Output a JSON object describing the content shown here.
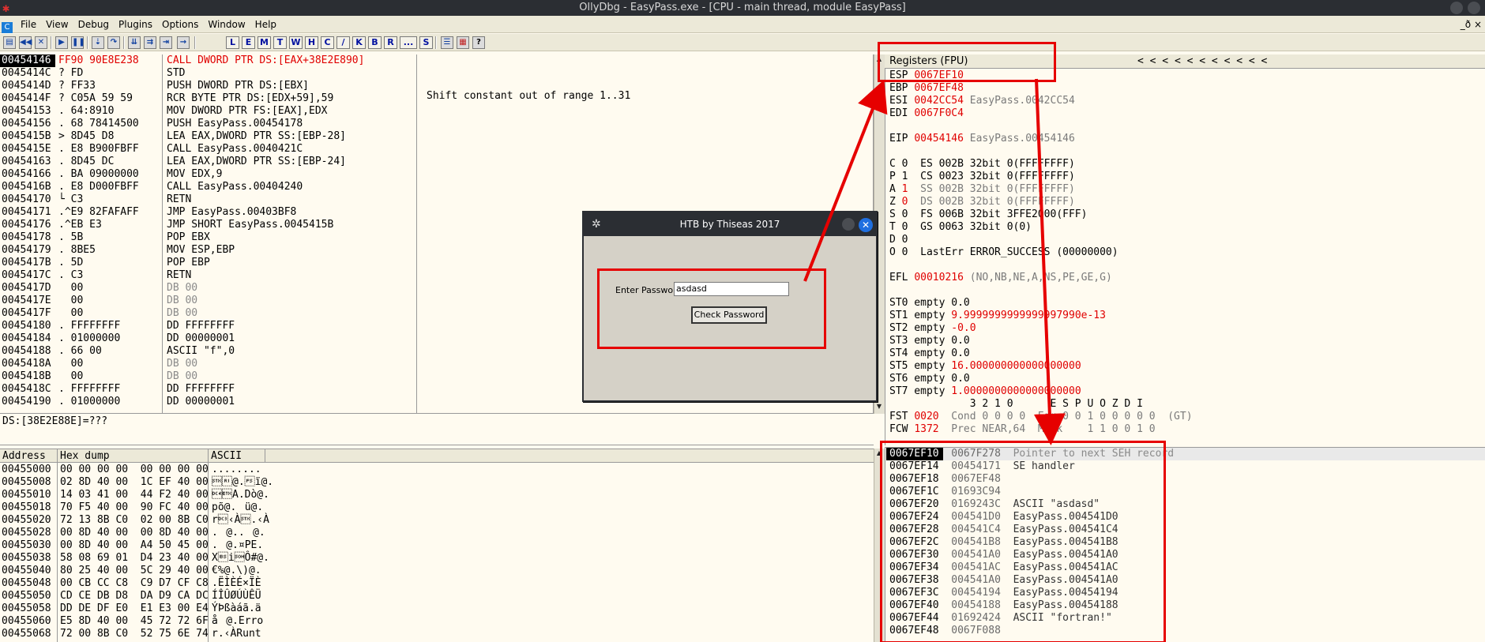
{
  "window": {
    "title": "OllyDbg - EasyPass.exe - [CPU - main thread, module EasyPass]"
  },
  "menu": {
    "items": [
      "File",
      "View",
      "Debug",
      "Plugins",
      "Options",
      "Window",
      "Help"
    ],
    "right": "_ð ×"
  },
  "toolbar": {
    "letters": [
      "L",
      "E",
      "M",
      "T",
      "W",
      "H",
      "C",
      "/",
      "K",
      "B",
      "R",
      "...",
      "S"
    ]
  },
  "cpu": {
    "addresses": "00454146\n0045414C\n0045414D\n0045414F\n00454153\n00454156\n0045415B\n0045415E\n00454163\n00454166\n0045416B\n00454170\n00454171\n00454176\n00454178\n00454179\n0045417B\n0045417C\n0045417D\n0045417E\n0045417F\n00454180\n00454184\n00454188\n0045418A\n0045418B\n0045418C\n00454190",
    "hex_first": "FF90 90E8E238",
    "hex_rest": "? FD\n? FF33\n? C05A 59 59\n. 64:8910\n. 68 78414500\n> 8D45 D8\n. E8 B900FBFF\n. 8D45 DC\n. BA 09000000\n. E8 D000FBFF\n└ C3\n.^E9 82FAFAFF\n.^EB E3\n. 5B\n. 8BE5\n. 5D\n. C3\n  00\n  00\n  00\n. FFFFFFFF\n. 01000000\n. 66 00\n  00\n  00\n. FFFFFFFF\n. 01000000",
    "dis_first": "CALL DWORD PTR DS:[EAX+38E2E890]",
    "dis_rest": "STD\nPUSH DWORD PTR DS:[EBX]\nRCR BYTE PTR DS:[EDX+59],59\nMOV DWORD PTR FS:[EAX],EDX\nPUSH EasyPass.00454178\nLEA EAX,DWORD PTR SS:[EBP-28]\nCALL EasyPass.0040421C\nLEA EAX,DWORD PTR SS:[EBP-24]\nMOV EDX,9\nCALL EasyPass.00404240\nRETN\nJMP EasyPass.00403BF8\nJMP SHORT EasyPass.0045415B\nPOP EBX\nMOV ESP,EBP\nPOP EBP\nRETN",
    "dis_gray": "DB 00\nDB 00\nDB 00",
    "dis_tail": "DD FFFFFFFF\nDD 00000001\nASCII \"f\",0",
    "dis_gray2": "DB 00\nDB 00",
    "dis_tail2": "DD FFFFFFFF\nDD 00000001",
    "comment": "Shift constant out of range 1..31",
    "info": "DS:[38E2E88E]=???"
  },
  "dump": {
    "headers": [
      "Address",
      "Hex dump",
      "ASCII"
    ],
    "addresses": "00455000\n00455008\n00455010\n00455018\n00455020\n00455028\n00455030\n00455038\n00455040\n00455048\n00455050\n00455058\n00455060\n00455068",
    "hex": "00 00 00 00|00 00 00 00\n02 8D 40 00|1C EF 40 00\n14 03 41 00|44 F2 40 00\n70 F5 40 00|90 FC 40 00\n72 13 8B C0|02 00 8B C0\n00 8D 40 00|00 8D 40 00\n00 8D 40 00|A4 50 45 00\n58 08 69 01|D4 23 40 00\n80 25 40 00|5C 29 40 00\n00 CB CC C8|C9 D7 CF C8\nCD CE DB D8|DA D9 CA DC\nDD DE DF E0|E1 E3 00 E4\nE5 8D 40 00|45 72 72 6F\n72 00 8B C0|52 75 6E 74",
    "ascii": "........\n\u0002@.\u001cï@.\n\u0014\u0003A.Dò@.\npõ@.ü@.\nr\u0013‹À\u0002.‹À\n.@..@.\n.@.¤PE.\nX\bi\u0001Ô#@.\n€%@.\\)@.\n.ËÌÈÉ×ÏÈ\nÍÎÛØÚÙÊÜ\nÝÞßàáã.ä\nå@.Erro\nr.‹ÀRunt"
  },
  "registers": {
    "header": "Registers (FPU)",
    "arrows": "<   <   <   <   <   <   <   <   <   <   <",
    "esp_name": "ESP",
    "esp_val": "0067EF10",
    "lines": [
      {
        "n": "EBP ",
        "r": "0067EF48",
        "g": ""
      },
      {
        "n": "ESI ",
        "r": "0042CC54",
        "g": " EasyPass.0042CC54"
      },
      {
        "n": "EDI ",
        "r": "0067F0C4",
        "g": ""
      },
      {
        "n": "",
        "r": "",
        "g": ""
      },
      {
        "n": "EIP ",
        "r": "00454146",
        "g": " EasyPass.00454146"
      },
      {
        "n": "",
        "r": "",
        "g": ""
      },
      {
        "n": "C 0  ES 002B 32bit 0(FFFFFFFF)",
        "r": "",
        "g": ""
      },
      {
        "n": "P 1  CS 0023 32bit 0(FFFFFFFF)",
        "r": "",
        "g": ""
      },
      {
        "n": "A ",
        "r": "1",
        "g": "  SS 002B 32bit 0(FFFFFFFF)"
      },
      {
        "n": "Z ",
        "r": "0",
        "g": "  DS 002B 32bit 0(FFFFFFFF)"
      },
      {
        "n": "S 0  FS 006B 32bit 3FFE2000(FFF)",
        "r": "",
        "g": ""
      },
      {
        "n": "T 0  GS 0063 32bit 0(0)",
        "r": "",
        "g": ""
      },
      {
        "n": "D 0",
        "r": "",
        "g": ""
      },
      {
        "n": "O 0  LastErr ERROR_SUCCESS (00000000)",
        "r": "",
        "g": ""
      },
      {
        "n": "",
        "r": "",
        "g": ""
      },
      {
        "n": "EFL ",
        "r": "00010216",
        "g": " (NO,NB,NE,A,NS,PE,GE,G)"
      },
      {
        "n": "",
        "r": "",
        "g": ""
      },
      {
        "n": "ST0 empty 0.0",
        "r": "",
        "g": ""
      },
      {
        "n": "ST1 empty ",
        "r": "9.9999999999999997990e-13",
        "g": ""
      },
      {
        "n": "ST2 empty ",
        "r": "-0.0",
        "g": ""
      },
      {
        "n": "ST3 empty 0.0",
        "r": "",
        "g": ""
      },
      {
        "n": "ST4 empty 0.0",
        "r": "",
        "g": ""
      },
      {
        "n": "ST5 empty ",
        "r": "16.000000000000000000",
        "g": ""
      },
      {
        "n": "ST6 empty 0.0",
        "r": "",
        "g": ""
      },
      {
        "n": "ST7 empty ",
        "r": "1.0000000000000000000",
        "g": ""
      },
      {
        "n": "             3 2 1 0      E S P U O Z D I",
        "r": "",
        "g": ""
      },
      {
        "n": "FST ",
        "r": "0020",
        "g": "  Cond 0 0 0 0  Err 0 0 1 0 0 0 0 0  (GT)"
      },
      {
        "n": "FCW ",
        "r": "1372",
        "g": "  Prec NEAR,64  Mask    1 1 0 0 1 0"
      }
    ]
  },
  "stack": {
    "rows": [
      {
        "addr": "0067EF10",
        "val": "0067F278",
        "cm": "Pointer to next SEH record"
      },
      {
        "addr": "0067EF14",
        "val": "00454171",
        "cm": "SE handler"
      },
      {
        "addr": "0067EF18",
        "val": "0067EF48",
        "cm": ""
      },
      {
        "addr": "0067EF1C",
        "val": "01693C94",
        "cm": ""
      },
      {
        "addr": "0067EF20",
        "val": "0169243C",
        "cm": "ASCII \"asdasd\""
      },
      {
        "addr": "0067EF24",
        "val": "004541D0",
        "cm": "EasyPass.004541D0"
      },
      {
        "addr": "0067EF28",
        "val": "004541C4",
        "cm": "EasyPass.004541C4"
      },
      {
        "addr": "0067EF2C",
        "val": "004541B8",
        "cm": "EasyPass.004541B8"
      },
      {
        "addr": "0067EF30",
        "val": "004541A0",
        "cm": "EasyPass.004541A0"
      },
      {
        "addr": "0067EF34",
        "val": "004541AC",
        "cm": "EasyPass.004541AC"
      },
      {
        "addr": "0067EF38",
        "val": "004541A0",
        "cm": "EasyPass.004541A0"
      },
      {
        "addr": "0067EF3C",
        "val": "00454194",
        "cm": "EasyPass.00454194"
      },
      {
        "addr": "0067EF40",
        "val": "00454188",
        "cm": "EasyPass.00454188"
      },
      {
        "addr": "0067EF44",
        "val": "01692424",
        "cm": "ASCII \"fortran!\""
      },
      {
        "addr": "0067EF48",
        "val": "0067F088",
        "cm": ""
      }
    ]
  },
  "dialog": {
    "title": "HTB by Thiseas 2017",
    "label": "Enter Password",
    "input_value": "asdasd",
    "button": "Check Password"
  },
  "colors": {
    "annotation": "#e60000",
    "register_changed": "#e00000",
    "background": "#fffbf0"
  }
}
